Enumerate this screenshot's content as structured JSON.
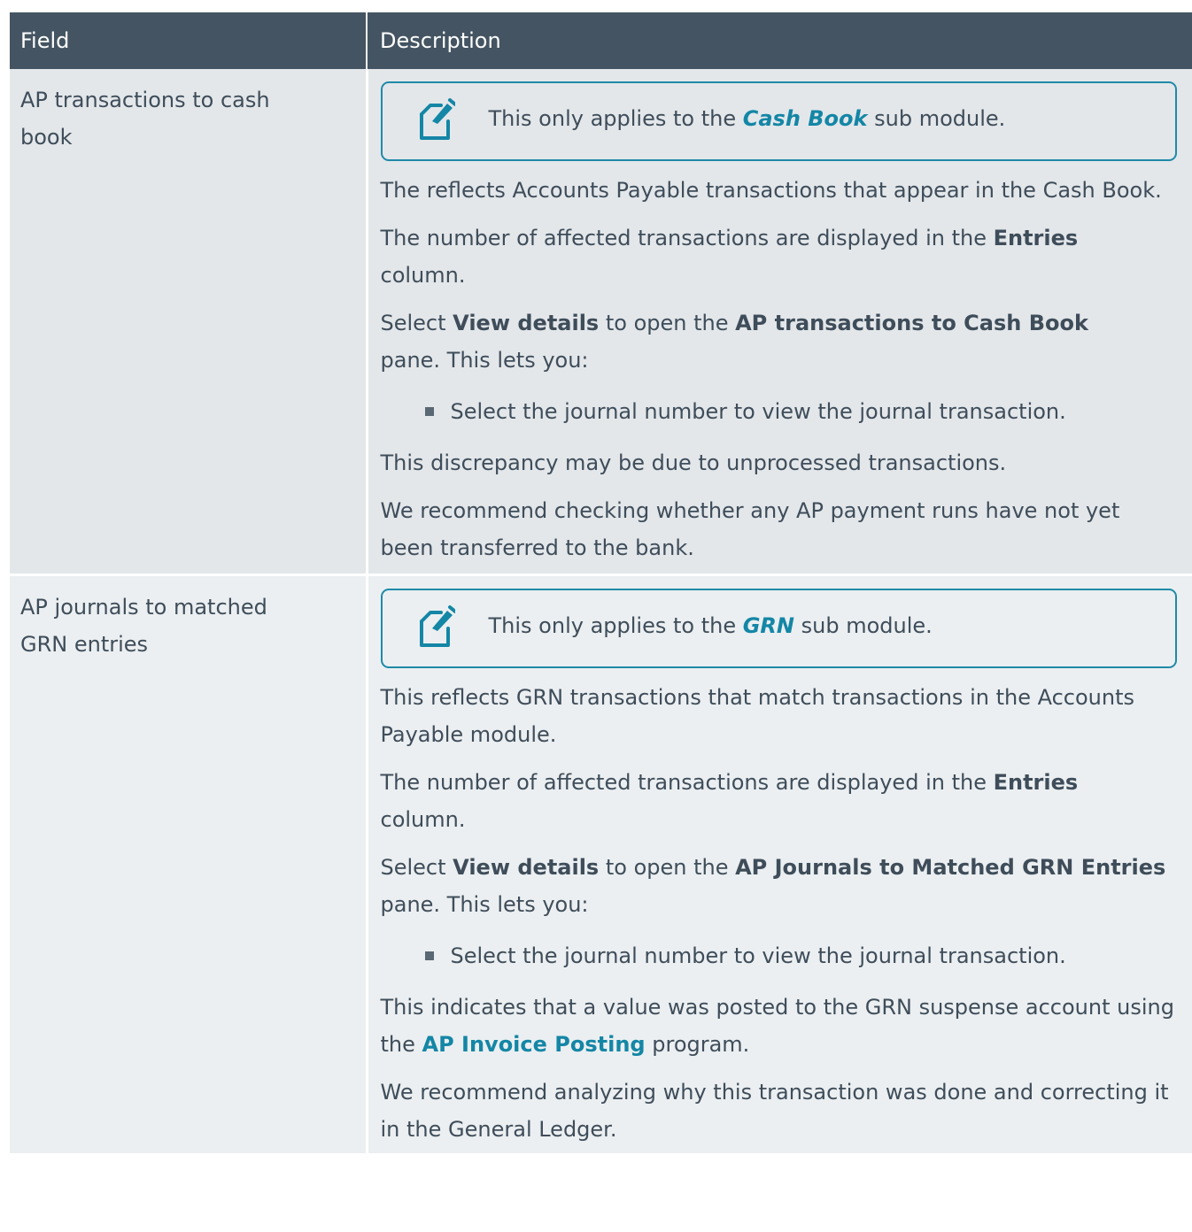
{
  "table": {
    "headers": {
      "field": "Field",
      "description": "Description"
    },
    "rows": [
      {
        "field": [
          "AP transactions to cash",
          "book"
        ],
        "note": {
          "before": "This only applies to the ",
          "link": "Cash Book",
          "after": " sub module."
        },
        "p1": "The reflects Accounts Payable transactions that appear in the Cash Book.",
        "p2": {
          "before": "The number of affected transactions are displayed in the ",
          "bold": "Entries",
          "after": " column."
        },
        "p3": {
          "t1": "Select ",
          "b1": "View details",
          "t2": " to open the ",
          "b2": "AP transactions to Cash Book",
          "t3": " pane. This lets you:"
        },
        "bullet": "Select the journal number to view the journal transaction.",
        "p4": "This discrepancy may be due to unprocessed transactions.",
        "p5": "We recommend checking whether any AP payment runs have not yet been transferred to the bank."
      },
      {
        "field": [
          "AP journals to matched",
          "GRN entries"
        ],
        "note": {
          "before": "This only applies to the ",
          "link": "GRN",
          "after": " sub module."
        },
        "p1": "This reflects GRN transactions that match transactions in the Accounts Payable module.",
        "p2": {
          "before": "The number of affected transactions are displayed in the ",
          "bold": "Entries",
          "after": " column."
        },
        "p3": {
          "t1": "Select ",
          "b1": "View details",
          "t2": " to open the ",
          "b2": "AP Journals to Matched GRN Entries",
          "t3": " pane. This lets you:"
        },
        "bullet": "Select the journal number to view the journal transaction.",
        "p4": {
          "before": "This indicates that a value was posted to the GRN suspense account using the ",
          "link": "AP Invoice Posting",
          "after": " program."
        },
        "p5": "We recommend analyzing why this transaction was done and correcting it in the General Ledger."
      }
    ]
  },
  "icons": {
    "note": "note-edit-icon",
    "bullet": "square-bullet-icon"
  },
  "colors": {
    "header_bg": "#445462",
    "row_bg_1": "#e3e7ea",
    "row_bg_2": "#ebeff1",
    "accent": "#1486a6",
    "text": "#3f4d5a"
  }
}
